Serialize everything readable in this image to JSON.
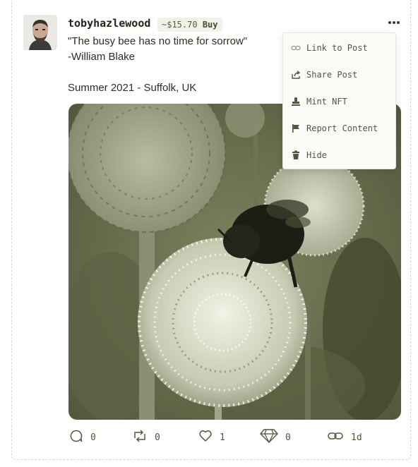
{
  "post": {
    "username": "tobyhazlewood",
    "price": "~$15.70",
    "buy_label": "Buy",
    "lines": [
      "\"The busy bee has no time for sorrow\"",
      "-William Blake",
      "Summer 2021 - Suffolk, UK"
    ],
    "image_alt": "Bumblebee on globe thistle flowers"
  },
  "menu": {
    "items": [
      {
        "label": "Link to Post",
        "icon": "link-icon"
      },
      {
        "label": "Share Post",
        "icon": "share-icon"
      },
      {
        "label": "Mint NFT",
        "icon": "stamp-icon"
      },
      {
        "label": "Report Content",
        "icon": "flag-icon"
      },
      {
        "label": "Hide",
        "icon": "trash-icon"
      }
    ]
  },
  "actions": {
    "comments": "0",
    "reposts": "0",
    "likes": "1",
    "diamonds": "0",
    "age": "1d"
  },
  "colors": {
    "photo_tint": "#5c6140",
    "text": "#2e2e22",
    "muted": "#55553f"
  }
}
